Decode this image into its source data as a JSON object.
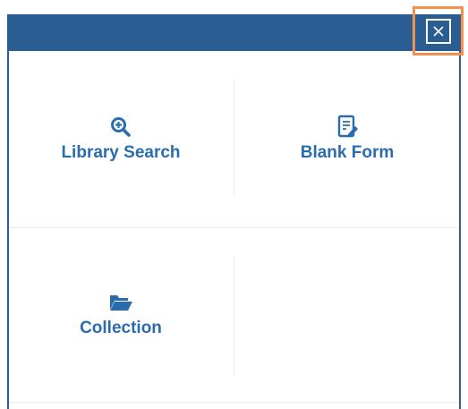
{
  "dialog": {
    "close_label": "×",
    "tiles": [
      {
        "label": "Library Search",
        "icon": "magnifier-plus-icon"
      },
      {
        "label": "Blank Form",
        "icon": "document-edit-icon"
      },
      {
        "label": "Collection",
        "icon": "folder-open-icon"
      }
    ]
  },
  "colors": {
    "header": "#2a5e93",
    "accent": "#2b6cad",
    "highlight": "#f1914b"
  }
}
